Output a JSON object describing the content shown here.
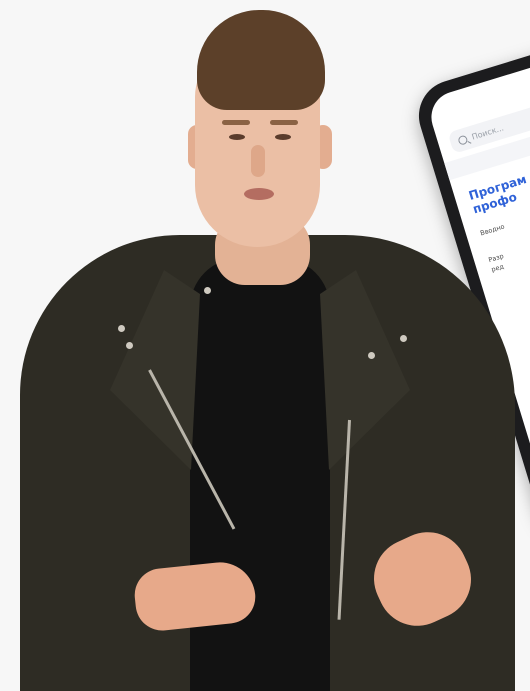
{
  "tablet": {
    "search_placeholder": "Поиск...",
    "title": "Програм\nпрофо",
    "line1": "Вводно",
    "line2": "Разр",
    "line3": "ред"
  },
  "colors": {
    "background": "#f7f7f7",
    "tablet_frame": "#1c1c1e",
    "tablet_title": "#2f62d8",
    "jacket": "#2e2c24",
    "shirt": "#121212",
    "skin": "#ebbfa5",
    "hair": "#5c4029"
  },
  "icons": {
    "tablet_search": "search-icon"
  }
}
